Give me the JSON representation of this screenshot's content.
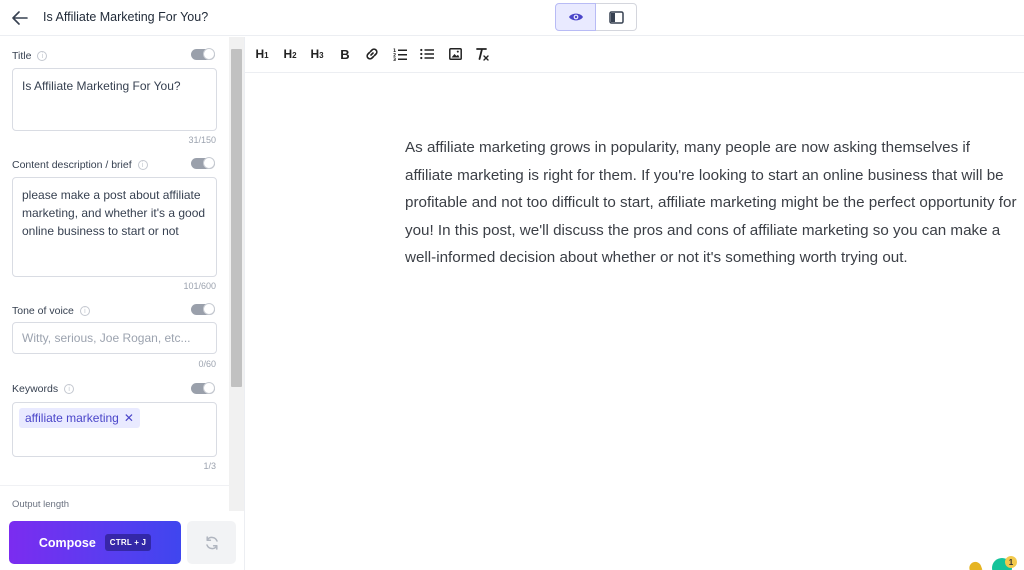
{
  "header": {
    "doc_title": "Is Affiliate Marketing For You?"
  },
  "sidebar": {
    "title_field": {
      "label": "Title",
      "value": "Is Affiliate Marketing For You?",
      "counter": "31/150"
    },
    "brief_field": {
      "label": "Content description / brief",
      "value": "please make a post about affiliate marketing, and whether it's a good online business to start or not",
      "counter": "101/600"
    },
    "tone_field": {
      "label": "Tone of voice",
      "placeholder": "Witty, serious, Joe Rogan, etc...",
      "counter": "0/60"
    },
    "keywords_field": {
      "label": "Keywords",
      "chips": [
        "affiliate marketing"
      ],
      "counter": "1/3"
    },
    "output_length_label": "Output length",
    "compose_label": "Compose",
    "compose_shortcut": "CTRL + J"
  },
  "toolbar": {
    "h1": "H",
    "h2": "H",
    "h3": "H",
    "bold": "B"
  },
  "editor": {
    "paragraph": "As affiliate marketing grows in popularity, many people are now asking themselves if affiliate marketing is right for them. If you're looking to start an online business that will be profitable and not too difficult to start, affiliate marketing might be the perfect opportunity for you! In this post, we'll discuss the pros and cons of affiliate marketing so you can make a well-informed decision about whether or not it's something worth trying out."
  },
  "colors": {
    "accent": "#4a45c9",
    "compose_gradient_start": "#7b2cf0",
    "compose_gradient_end": "#3f46ef"
  },
  "icons": [
    "arrow-left-icon",
    "eye-icon",
    "sidebar-layout-icon",
    "info-icon",
    "link-icon",
    "ordered-list-icon",
    "bullet-list-icon",
    "image-icon",
    "clear-format-icon",
    "refresh-icon"
  ]
}
